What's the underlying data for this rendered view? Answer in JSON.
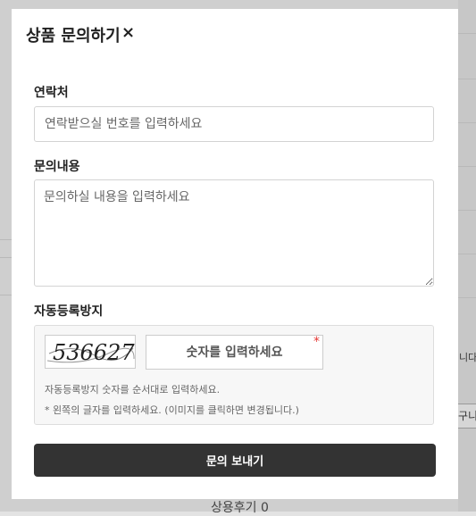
{
  "modal": {
    "title": "상품 문의하기",
    "close_label": "×"
  },
  "contact": {
    "label": "연락처",
    "placeholder": "연락받으실 번호를 입력하세요",
    "value": ""
  },
  "inquiry": {
    "label": "문의내용",
    "placeholder": "문의하실 내용을 입력하세요",
    "value": ""
  },
  "captcha": {
    "label": "자동등록방지",
    "image_text": "536627",
    "input_placeholder": "숫자를 입력하세요",
    "required_mark": "*",
    "note_1": "자동등록방지 숫자를 순서대로 입력하세요.",
    "note_2": "* 왼쪽의 글자를 입력하세요. (이미지를 클릭하면 변경됩니다.)"
  },
  "submit_label": "문의 보내기",
  "background": {
    "right_text": "니다.",
    "right_button": "구니",
    "bottom_text": "상용후기 0"
  }
}
